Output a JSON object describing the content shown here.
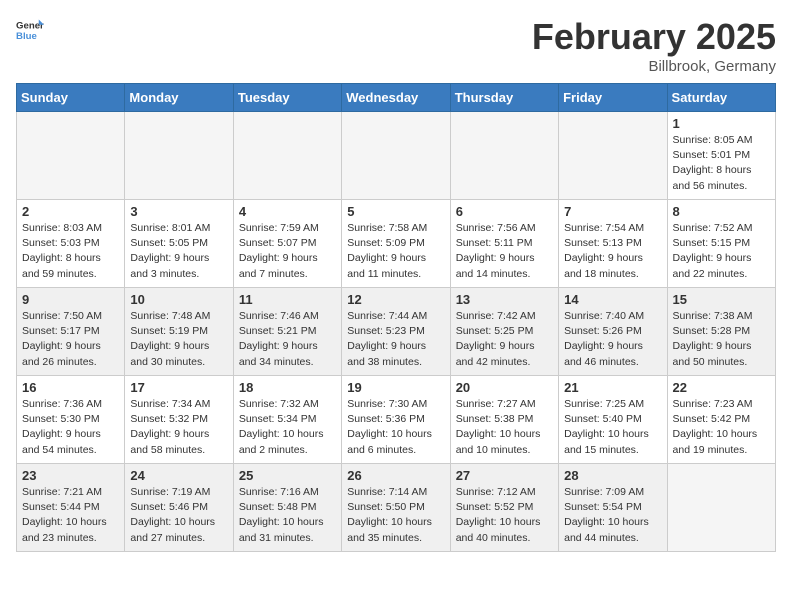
{
  "header": {
    "logo_general": "General",
    "logo_blue": "Blue",
    "title": "February 2025",
    "subtitle": "Billbrook, Germany"
  },
  "weekdays": [
    "Sunday",
    "Monday",
    "Tuesday",
    "Wednesday",
    "Thursday",
    "Friday",
    "Saturday"
  ],
  "weeks": [
    [
      {
        "num": "",
        "info": "",
        "empty": true
      },
      {
        "num": "",
        "info": "",
        "empty": true
      },
      {
        "num": "",
        "info": "",
        "empty": true
      },
      {
        "num": "",
        "info": "",
        "empty": true
      },
      {
        "num": "",
        "info": "",
        "empty": true
      },
      {
        "num": "",
        "info": "",
        "empty": true
      },
      {
        "num": "1",
        "info": "Sunrise: 8:05 AM\nSunset: 5:01 PM\nDaylight: 8 hours\nand 56 minutes."
      }
    ],
    [
      {
        "num": "2",
        "info": "Sunrise: 8:03 AM\nSunset: 5:03 PM\nDaylight: 8 hours\nand 59 minutes."
      },
      {
        "num": "3",
        "info": "Sunrise: 8:01 AM\nSunset: 5:05 PM\nDaylight: 9 hours\nand 3 minutes."
      },
      {
        "num": "4",
        "info": "Sunrise: 7:59 AM\nSunset: 5:07 PM\nDaylight: 9 hours\nand 7 minutes."
      },
      {
        "num": "5",
        "info": "Sunrise: 7:58 AM\nSunset: 5:09 PM\nDaylight: 9 hours\nand 11 minutes."
      },
      {
        "num": "6",
        "info": "Sunrise: 7:56 AM\nSunset: 5:11 PM\nDaylight: 9 hours\nand 14 minutes."
      },
      {
        "num": "7",
        "info": "Sunrise: 7:54 AM\nSunset: 5:13 PM\nDaylight: 9 hours\nand 18 minutes."
      },
      {
        "num": "8",
        "info": "Sunrise: 7:52 AM\nSunset: 5:15 PM\nDaylight: 9 hours\nand 22 minutes."
      }
    ],
    [
      {
        "num": "9",
        "info": "Sunrise: 7:50 AM\nSunset: 5:17 PM\nDaylight: 9 hours\nand 26 minutes.",
        "shaded": true
      },
      {
        "num": "10",
        "info": "Sunrise: 7:48 AM\nSunset: 5:19 PM\nDaylight: 9 hours\nand 30 minutes.",
        "shaded": true
      },
      {
        "num": "11",
        "info": "Sunrise: 7:46 AM\nSunset: 5:21 PM\nDaylight: 9 hours\nand 34 minutes.",
        "shaded": true
      },
      {
        "num": "12",
        "info": "Sunrise: 7:44 AM\nSunset: 5:23 PM\nDaylight: 9 hours\nand 38 minutes.",
        "shaded": true
      },
      {
        "num": "13",
        "info": "Sunrise: 7:42 AM\nSunset: 5:25 PM\nDaylight: 9 hours\nand 42 minutes.",
        "shaded": true
      },
      {
        "num": "14",
        "info": "Sunrise: 7:40 AM\nSunset: 5:26 PM\nDaylight: 9 hours\nand 46 minutes.",
        "shaded": true
      },
      {
        "num": "15",
        "info": "Sunrise: 7:38 AM\nSunset: 5:28 PM\nDaylight: 9 hours\nand 50 minutes.",
        "shaded": true
      }
    ],
    [
      {
        "num": "16",
        "info": "Sunrise: 7:36 AM\nSunset: 5:30 PM\nDaylight: 9 hours\nand 54 minutes."
      },
      {
        "num": "17",
        "info": "Sunrise: 7:34 AM\nSunset: 5:32 PM\nDaylight: 9 hours\nand 58 minutes."
      },
      {
        "num": "18",
        "info": "Sunrise: 7:32 AM\nSunset: 5:34 PM\nDaylight: 10 hours\nand 2 minutes."
      },
      {
        "num": "19",
        "info": "Sunrise: 7:30 AM\nSunset: 5:36 PM\nDaylight: 10 hours\nand 6 minutes."
      },
      {
        "num": "20",
        "info": "Sunrise: 7:27 AM\nSunset: 5:38 PM\nDaylight: 10 hours\nand 10 minutes."
      },
      {
        "num": "21",
        "info": "Sunrise: 7:25 AM\nSunset: 5:40 PM\nDaylight: 10 hours\nand 15 minutes."
      },
      {
        "num": "22",
        "info": "Sunrise: 7:23 AM\nSunset: 5:42 PM\nDaylight: 10 hours\nand 19 minutes."
      }
    ],
    [
      {
        "num": "23",
        "info": "Sunrise: 7:21 AM\nSunset: 5:44 PM\nDaylight: 10 hours\nand 23 minutes.",
        "shaded": true
      },
      {
        "num": "24",
        "info": "Sunrise: 7:19 AM\nSunset: 5:46 PM\nDaylight: 10 hours\nand 27 minutes.",
        "shaded": true
      },
      {
        "num": "25",
        "info": "Sunrise: 7:16 AM\nSunset: 5:48 PM\nDaylight: 10 hours\nand 31 minutes.",
        "shaded": true
      },
      {
        "num": "26",
        "info": "Sunrise: 7:14 AM\nSunset: 5:50 PM\nDaylight: 10 hours\nand 35 minutes.",
        "shaded": true
      },
      {
        "num": "27",
        "info": "Sunrise: 7:12 AM\nSunset: 5:52 PM\nDaylight: 10 hours\nand 40 minutes.",
        "shaded": true
      },
      {
        "num": "28",
        "info": "Sunrise: 7:09 AM\nSunset: 5:54 PM\nDaylight: 10 hours\nand 44 minutes.",
        "shaded": true
      },
      {
        "num": "",
        "info": "",
        "empty": true
      }
    ]
  ]
}
